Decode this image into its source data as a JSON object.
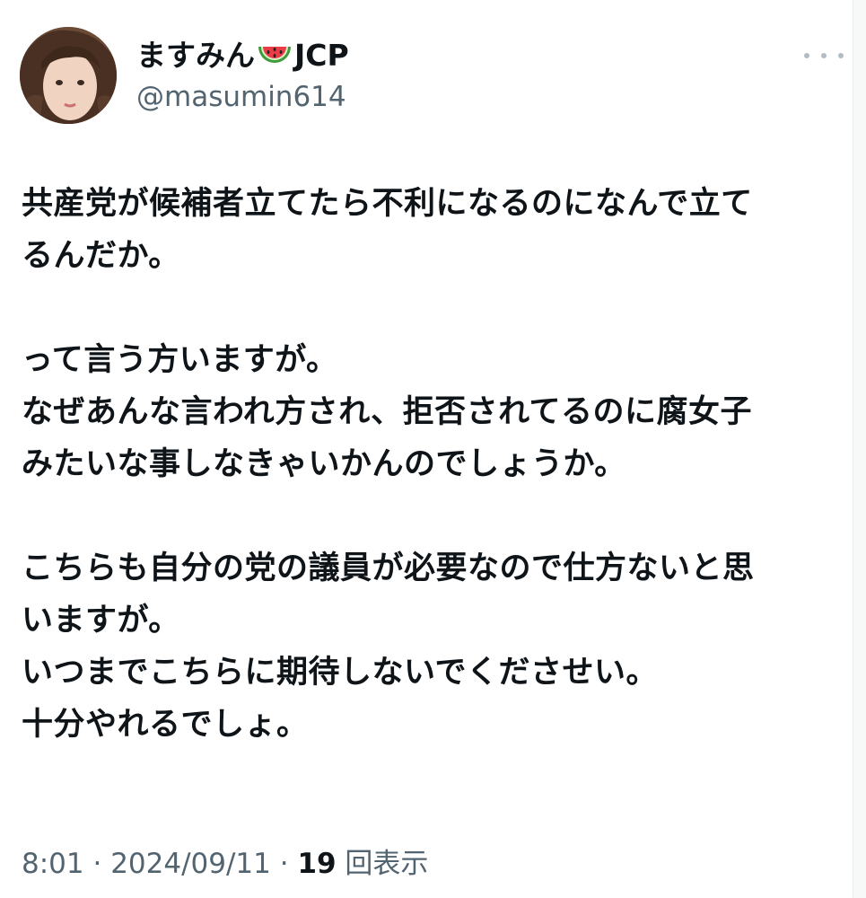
{
  "author": {
    "name_prefix": "ますみん",
    "name_suffix": "JCP",
    "emoji": "watermelon-icon",
    "handle": "@masumin614"
  },
  "tweet": {
    "lines": [
      "共産党が候補者立てたら不利になるのになんで立て",
      "るんだか。",
      "",
      "って言う方いますが。",
      "なぜあんな言われ方され、拒否されてるのに腐女子",
      "みたいな事しなきゃいかんのでしょうか。",
      "",
      "こちらも自分の党の議員が必要なので仕方ないと思",
      "いますが。",
      "いつまでこちらに期待しないでくださせい。",
      "十分やれるでしょ。"
    ]
  },
  "meta": {
    "time": "8:01",
    "separator1": " · ",
    "date": "2024/09/11",
    "separator2": " · ",
    "views_count": "19",
    "views_label": " 回表示"
  },
  "colors": {
    "text": "#0f1419",
    "secondary": "#536471",
    "more_dots": "#b3bcc3"
  }
}
